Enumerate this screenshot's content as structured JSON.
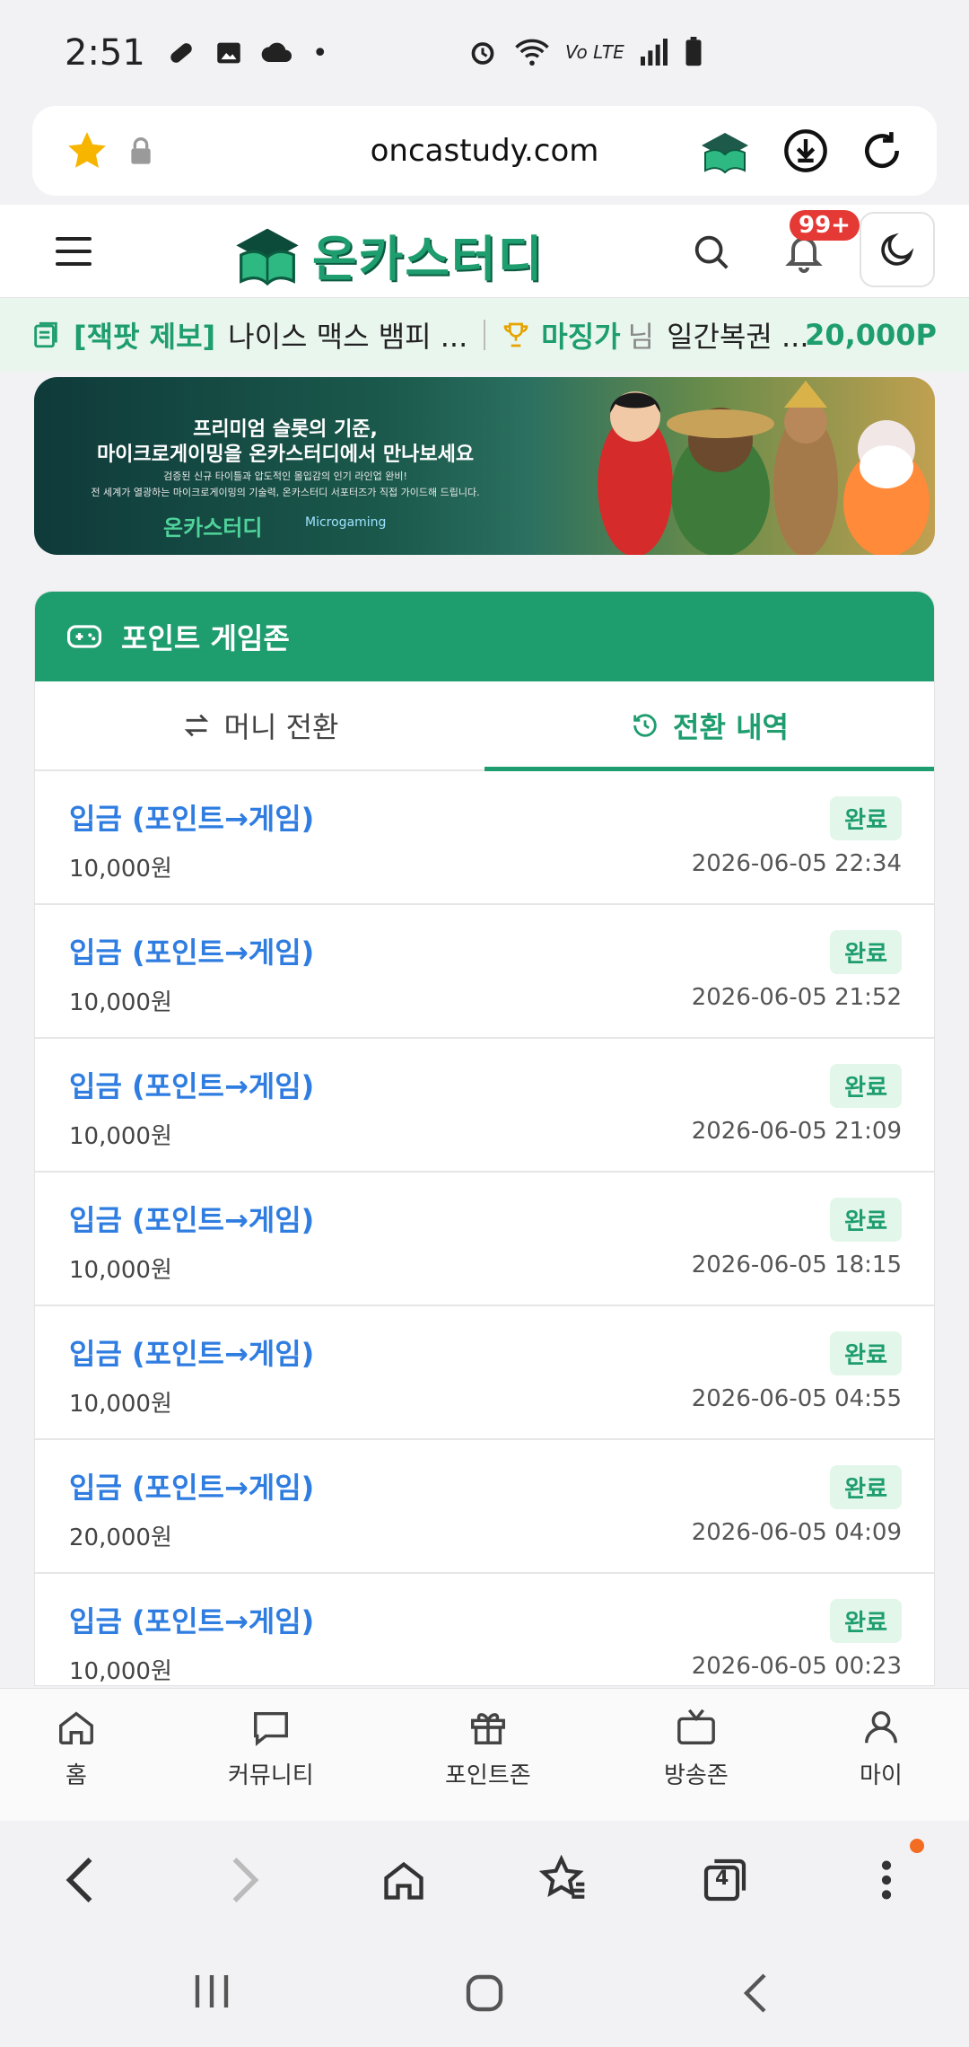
{
  "status_bar": {
    "time": "2:51",
    "network": "Vo LTE"
  },
  "browser": {
    "url": "oncastudy.com",
    "tabs_count": "4"
  },
  "site": {
    "logo_text": "온카스터디",
    "notification_badge": "99+"
  },
  "ticker": {
    "tag": "[잭팟 제보]",
    "message": "나이스 맥스 뱀피 ...",
    "nickname": "마징가",
    "suffix": "님",
    "message2": "일간복권 ...",
    "points": "20,000P"
  },
  "banner": {
    "line1": "프리미엄 슬롯의 기준,",
    "line2": "마이크로게이밍을 온카스터디에서 만나보세요",
    "line3": "검증된 신규 타이틀과 압도적인 몰입감의 인기 라인업 완비!",
    "line4": "전 세계가 열광하는 마이크로게이밍의 기술력, 온카스터디 서포터즈가 직접 가이드해 드립니다.",
    "logo": "온카스터디",
    "partner": "Microgaming"
  },
  "zone": {
    "title": "포인트 게임존",
    "tabs": [
      {
        "label": "머니 전환"
      },
      {
        "label": "전환 내역"
      }
    ],
    "active_tab": 1,
    "rows": [
      {
        "title": "입금 (포인트→게임)",
        "amount": "10,000원",
        "status": "완료",
        "date": "2026-06-05 22:34"
      },
      {
        "title": "입금 (포인트→게임)",
        "amount": "10,000원",
        "status": "완료",
        "date": "2026-06-05 21:52"
      },
      {
        "title": "입금 (포인트→게임)",
        "amount": "10,000원",
        "status": "완료",
        "date": "2026-06-05 21:09"
      },
      {
        "title": "입금 (포인트→게임)",
        "amount": "10,000원",
        "status": "완료",
        "date": "2026-06-05 18:15"
      },
      {
        "title": "입금 (포인트→게임)",
        "amount": "10,000원",
        "status": "완료",
        "date": "2026-06-05 04:55"
      },
      {
        "title": "입금 (포인트→게임)",
        "amount": "20,000원",
        "status": "완료",
        "date": "2026-06-05 04:09"
      },
      {
        "title": "입금 (포인트→게임)",
        "amount": "10,000원",
        "status": "완료",
        "date": "2026-06-05 00:23"
      }
    ]
  },
  "bottom_nav": [
    {
      "label": "홈",
      "icon": "home-icon"
    },
    {
      "label": "커뮤니티",
      "icon": "chat-icon"
    },
    {
      "label": "포인트존",
      "icon": "gift-icon"
    },
    {
      "label": "방송존",
      "icon": "tv-icon"
    },
    {
      "label": "마이",
      "icon": "user-icon"
    }
  ],
  "colors": {
    "brand_green": "#1e9d6f",
    "link_blue": "#2f7de1",
    "badge_red": "#e53935",
    "status_bg": "#e2f6ea"
  }
}
